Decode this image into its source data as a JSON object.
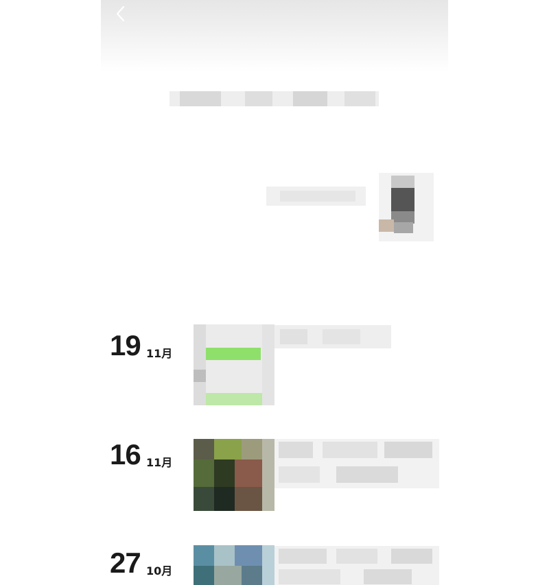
{
  "nav": {
    "back_icon": "chevron-left-icon"
  },
  "profile": {
    "avatar_icon": "avatar-icon"
  },
  "colors": {
    "text": "#1a1a1a",
    "header_top": "#e6e6e6",
    "thumb_green": "#8ee06a"
  },
  "posts": [
    {
      "day": "19",
      "month": "11月",
      "thumb_icon": "screenshot-thumbnail"
    },
    {
      "day": "16",
      "month": "11月",
      "thumb_icon": "photo-thumbnail"
    },
    {
      "day": "27",
      "month": "10月",
      "thumb_icon": "photo-thumbnail"
    }
  ]
}
